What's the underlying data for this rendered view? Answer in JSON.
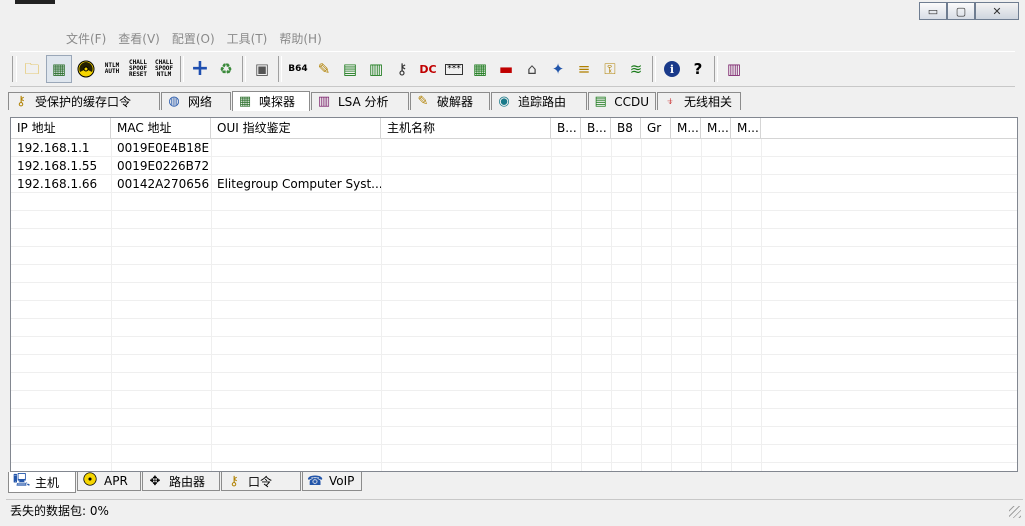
{
  "window": {
    "controls": {
      "minimize": "▭",
      "maximize": "▢",
      "close": "✕"
    }
  },
  "menu": [
    "文件(F)",
    "查看(V)",
    "配置(O)",
    "工具(T)",
    "帮助(H)"
  ],
  "toolbar": {
    "text_buttons": [
      {
        "name": "ntlm-auth",
        "text": "NTLM AUTH"
      },
      {
        "name": "chall-spoof-reset",
        "text": "CHALL SPOOF RESET"
      },
      {
        "name": "chall-spoof-ntlm",
        "text": "CHALL SPOOF NTLM"
      }
    ],
    "b64_label": "B64"
  },
  "top_tabs": [
    {
      "label": "受保护的缓存口令",
      "icon": "key-icon"
    },
    {
      "label": "网络",
      "icon": "network-icon"
    },
    {
      "label": "嗅探器",
      "icon": "sniffer-icon",
      "active": true
    },
    {
      "label": "LSA 分析",
      "icon": "lsa-icon"
    },
    {
      "label": "破解器",
      "icon": "cracker-icon"
    },
    {
      "label": "追踪路由",
      "icon": "traceroute-icon"
    },
    {
      "label": "CCDU",
      "icon": "ccdu-icon"
    },
    {
      "label": "无线相关",
      "icon": "wireless-icon"
    }
  ],
  "table": {
    "columns": [
      "IP 地址",
      "MAC 地址",
      "OUI 指纹鉴定",
      "主机名称",
      "B...",
      "B...",
      "B8",
      "Gr",
      "M...",
      "M...",
      "M..."
    ],
    "rows": [
      [
        "192.168.1.1",
        "0019E0E4B18E",
        "",
        "",
        "",
        "",
        "",
        "",
        "",
        "",
        ""
      ],
      [
        "192.168.1.55",
        "0019E0226B72",
        "",
        "",
        "",
        "",
        "",
        "",
        "",
        "",
        ""
      ],
      [
        "192.168.1.66",
        "00142A270656",
        "Elitegroup Computer Syst...",
        "",
        "",
        "",
        "",
        "",
        "",
        "",
        ""
      ]
    ]
  },
  "bottom_tabs": [
    {
      "label": "主机",
      "icon": "host-icon",
      "active": true
    },
    {
      "label": "APR",
      "icon": "radiation-icon"
    },
    {
      "label": "路由器",
      "icon": "router-icon"
    },
    {
      "label": "口令",
      "icon": "password-icon"
    },
    {
      "label": "VoIP",
      "icon": "voip-icon"
    }
  ],
  "status": {
    "text": "丢失的数据包: 0%"
  }
}
